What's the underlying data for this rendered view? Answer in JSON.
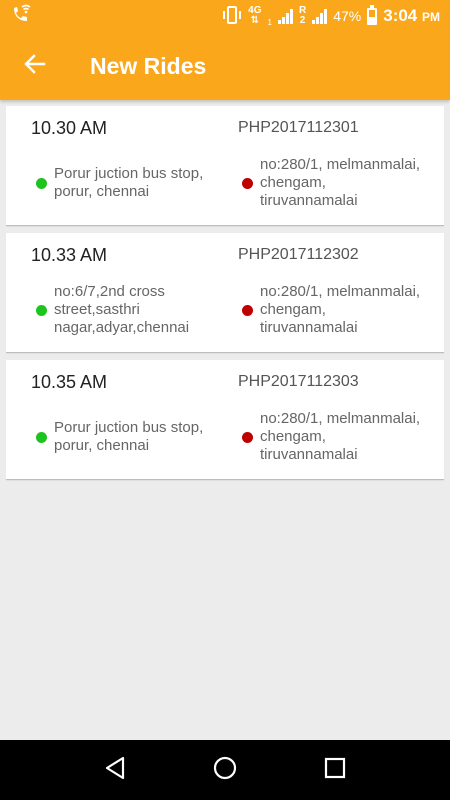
{
  "status_bar": {
    "network": "4G",
    "sim1": "1",
    "roaming": "R",
    "sim2": "2",
    "battery": "47%",
    "time": "3:04",
    "ampm": "PM"
  },
  "app_bar": {
    "title": "New Rides",
    "back_icon": "arrow-left-icon"
  },
  "rides": [
    {
      "time": "10.30 AM",
      "id": "PHP2017112301",
      "from": [
        "Porur juction bus stop,",
        "porur, chennai"
      ],
      "to": [
        "no:280/1, melmanmalai,",
        "chengam,",
        "tiruvannamalai"
      ]
    },
    {
      "time": "10.33 AM",
      "id": "PHP2017112302",
      "from": [
        "no:6/7,2nd cross",
        "street,sasthri",
        "nagar,adyar,chennai"
      ],
      "to": [
        "no:280/1, melmanmalai,",
        "chengam,",
        "tiruvannamalai"
      ]
    },
    {
      "time": "10.35 AM",
      "id": "PHP2017112303",
      "from": [
        "Porur juction bus stop,",
        "porur, chennai"
      ],
      "to": [
        "no:280/1, melmanmalai,",
        "chengam,",
        "tiruvannamalai"
      ]
    }
  ],
  "colors": {
    "accent": "#fba71b",
    "origin_dot": "#1ec41e",
    "destination_dot": "#c00000"
  },
  "nav_bar": {
    "back": "triangle-back-icon",
    "home": "circle-home-icon",
    "recents": "square-recents-icon"
  }
}
